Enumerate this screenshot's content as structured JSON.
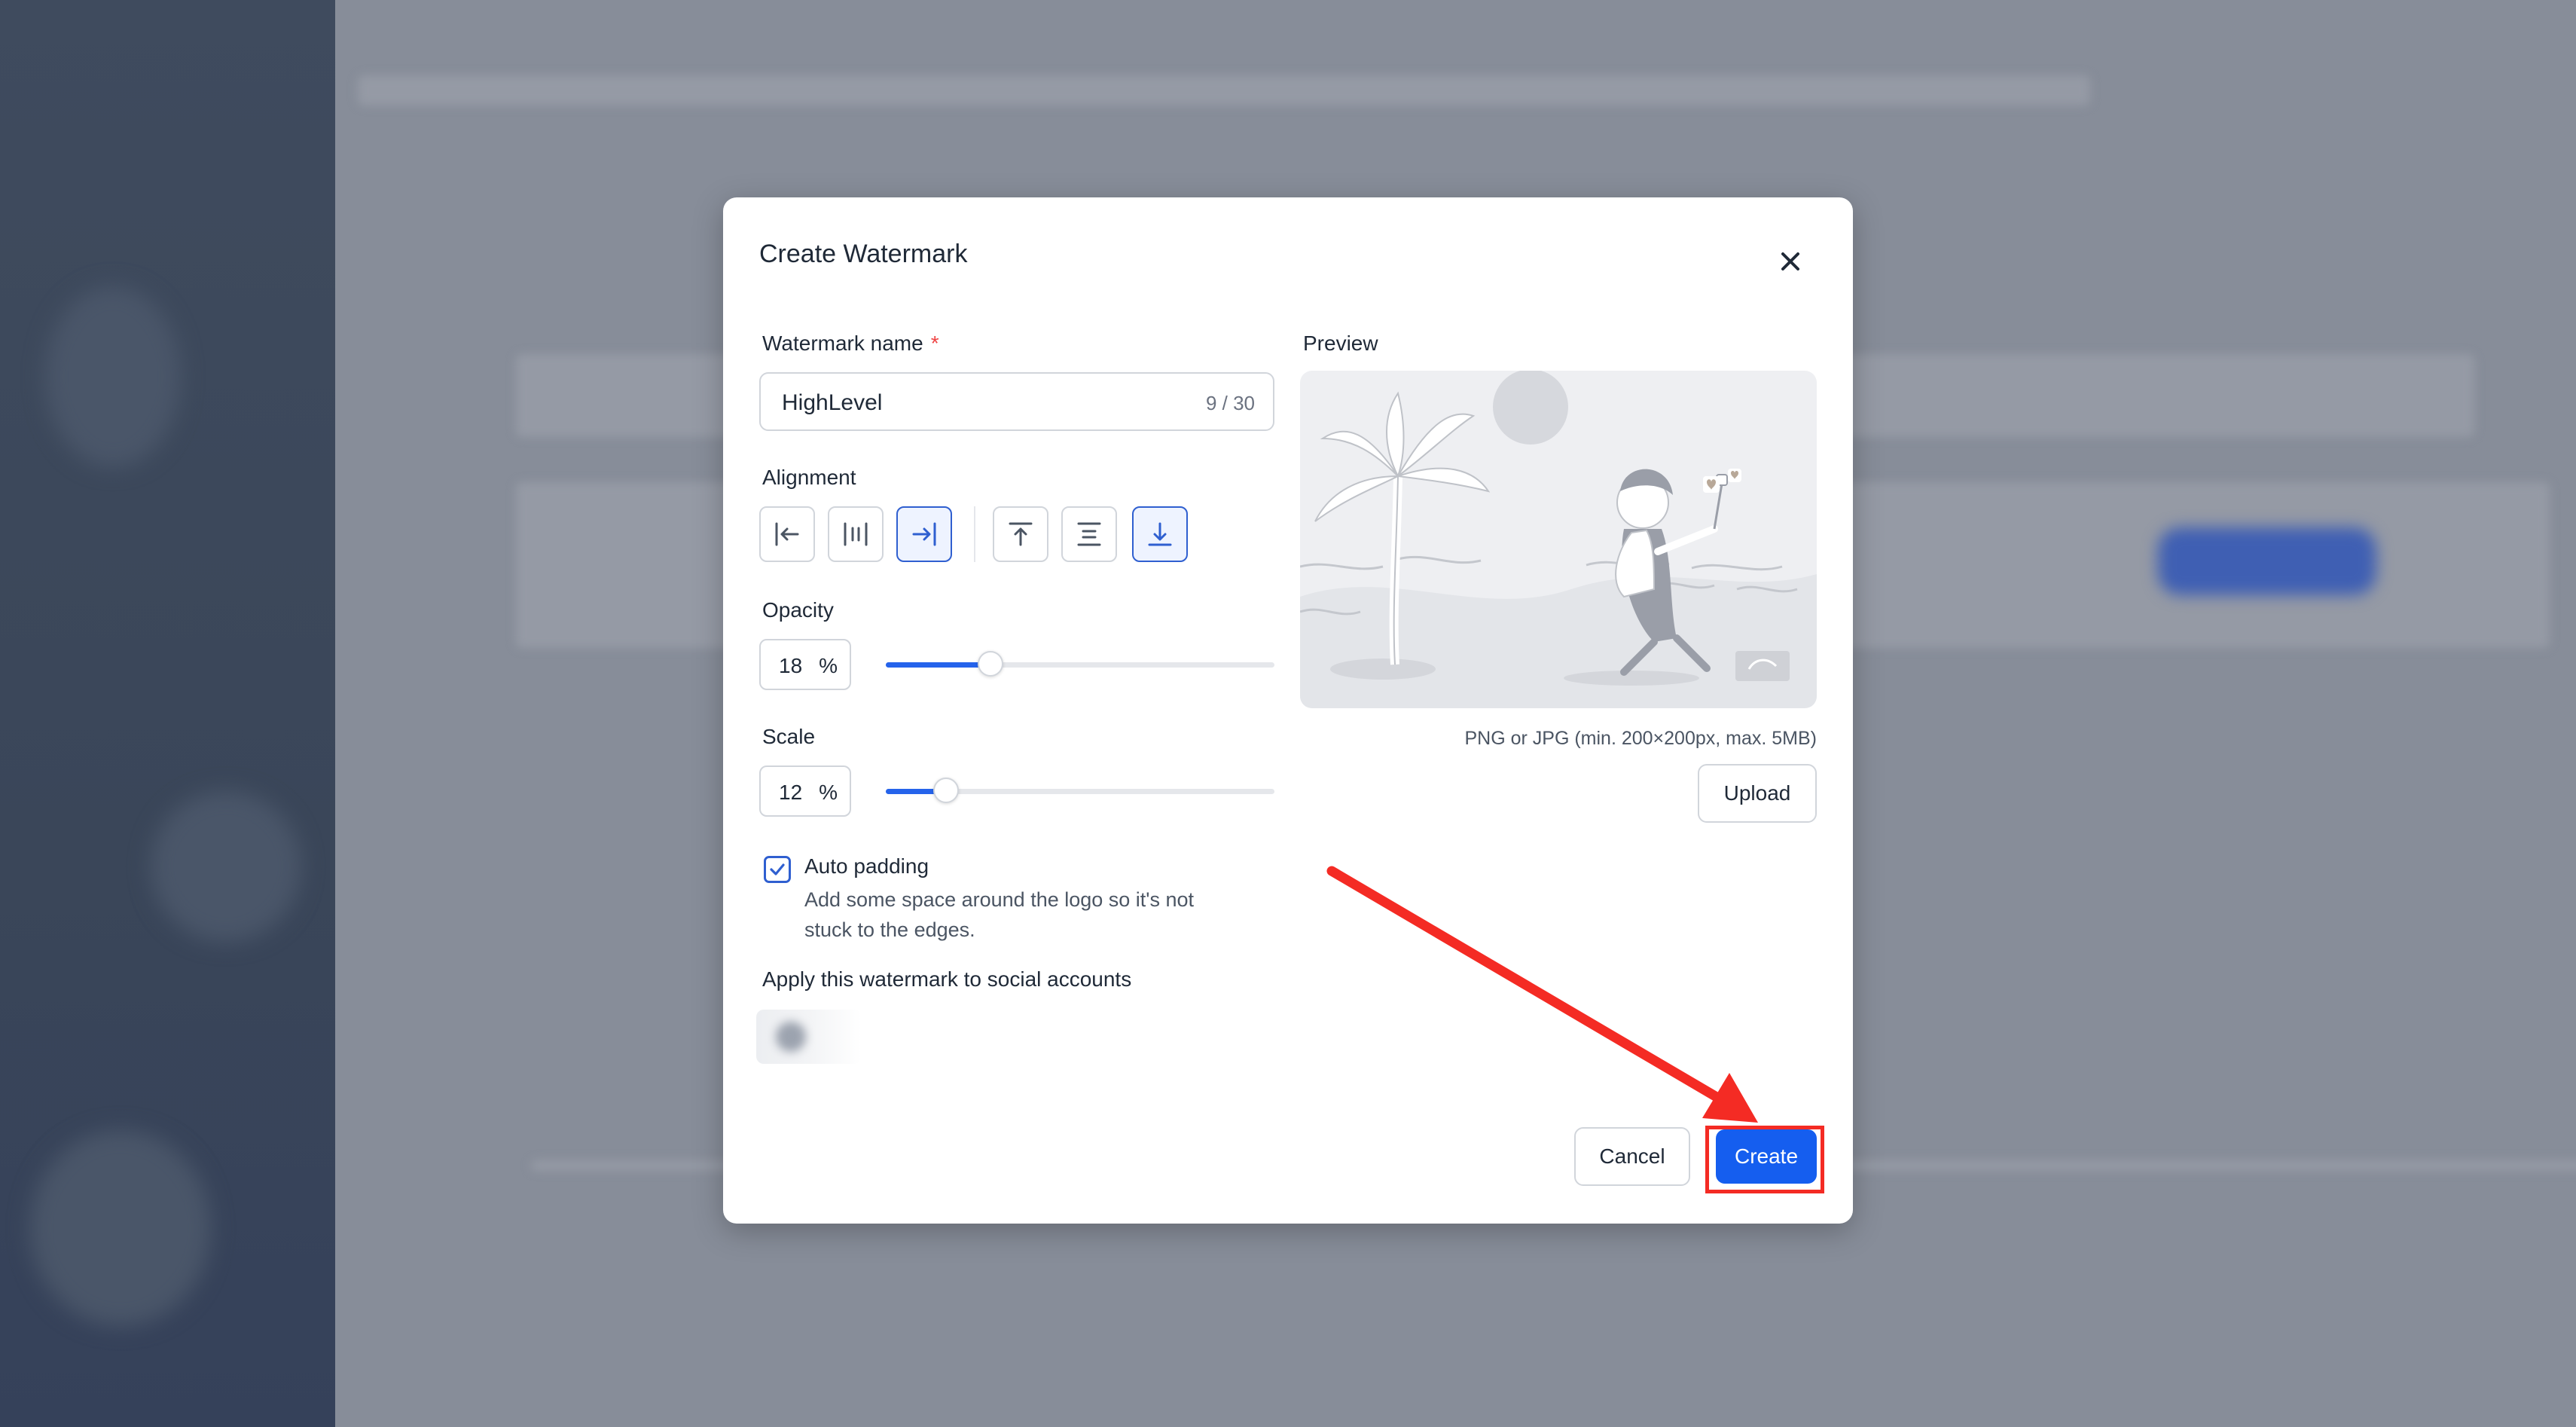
{
  "dialog": {
    "title": "Create Watermark",
    "name_label": "Watermark name",
    "required_mark": "*",
    "name_value": "HighLevel",
    "name_counter": "9 / 30",
    "alignment_label": "Alignment",
    "alignment_options": [
      "align-left",
      "align-center",
      "align-right",
      "align-top",
      "align-middle",
      "align-bottom"
    ],
    "alignment_selected": [
      "align-right",
      "align-bottom"
    ],
    "opacity_label": "Opacity",
    "opacity_value": "18",
    "opacity_unit": "%",
    "opacity_fraction": 0.18,
    "scale_label": "Scale",
    "scale_value": "12",
    "scale_unit": "%",
    "scale_fraction": 0.12,
    "auto_padding_label": "Auto padding",
    "auto_padding_checked": true,
    "auto_padding_desc": "Add some space around the logo so it's not stuck to the edges.",
    "social_label": "Apply this watermark to social accounts",
    "preview_label": "Preview",
    "upload_hint": "PNG or JPG (min. 200×200px, max. 5MB)",
    "upload_button": "Upload",
    "cancel_button": "Cancel",
    "create_button": "Create"
  },
  "colors": {
    "primary": "#155eef",
    "annotation": "#f42b24",
    "required": "#ef4444"
  }
}
